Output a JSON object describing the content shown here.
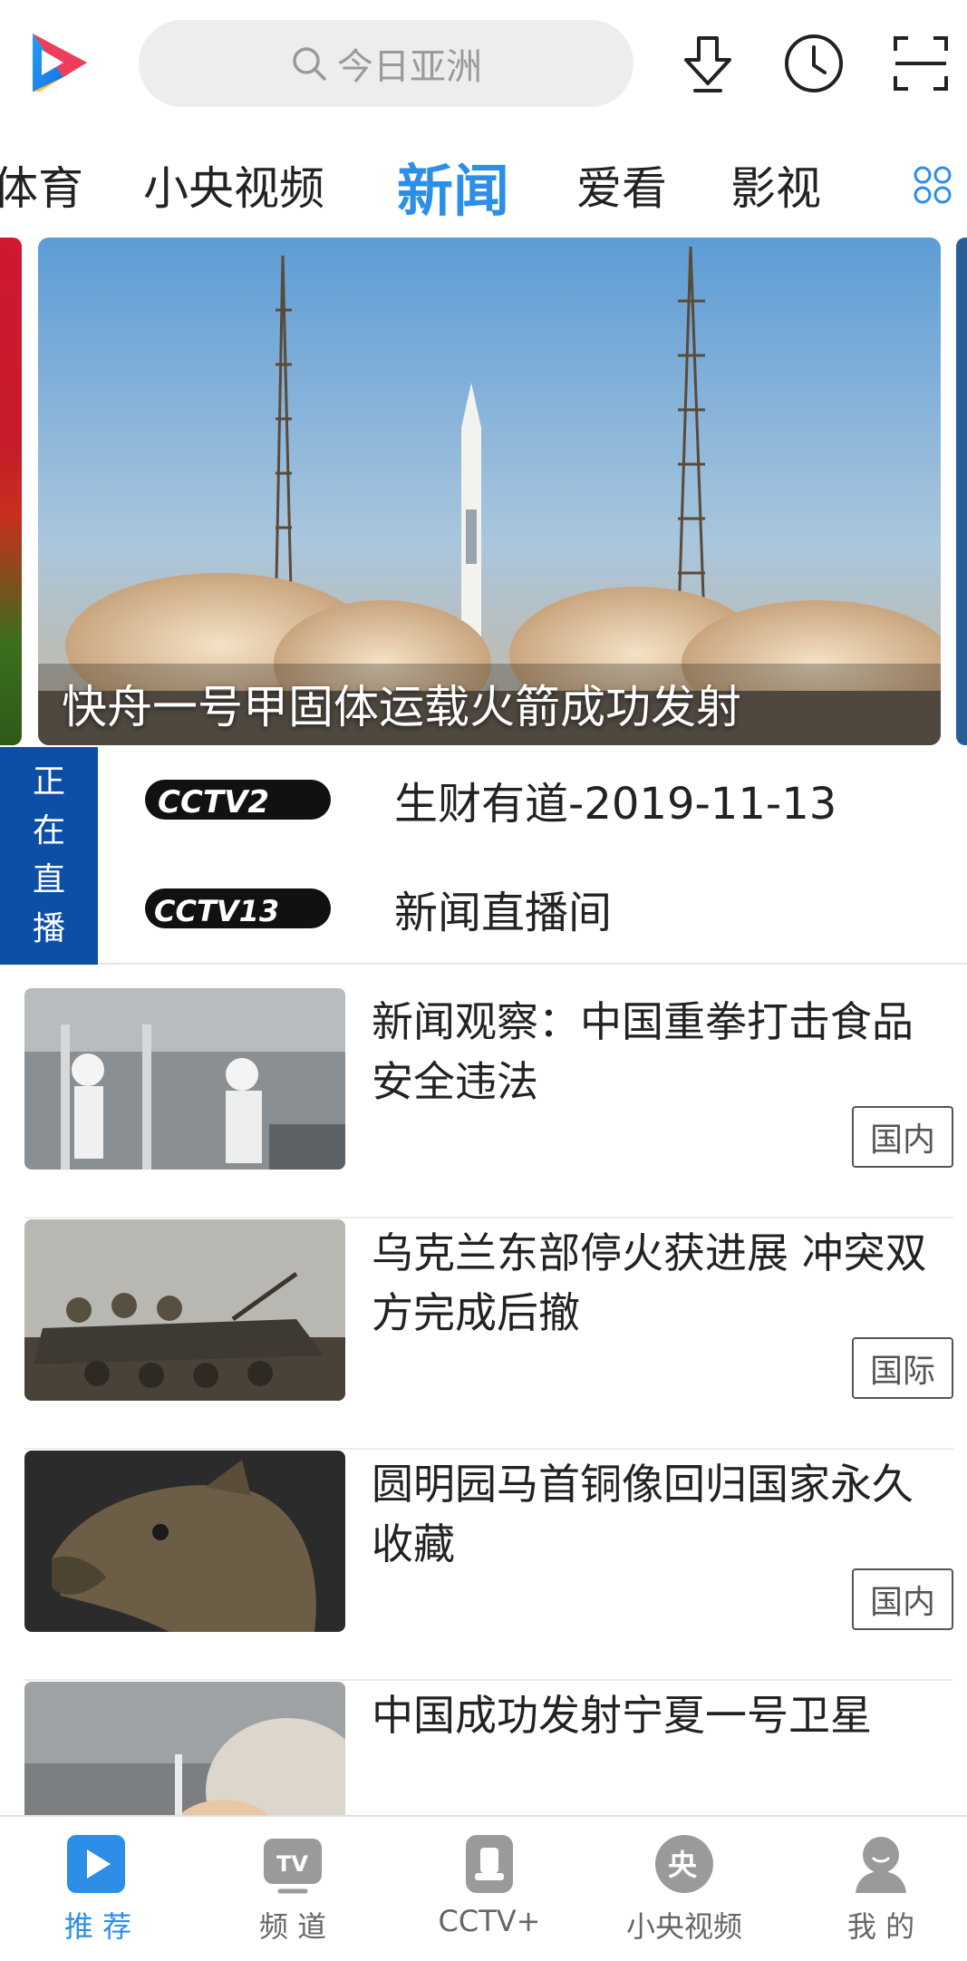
{
  "header": {
    "search_placeholder": "今日亚洲",
    "icons": [
      "app-logo",
      "search-icon",
      "download-icon",
      "history-clock-icon",
      "scan-icon"
    ]
  },
  "tabs": {
    "items": [
      "体育",
      "小央视频",
      "新闻",
      "爱看",
      "影视"
    ],
    "active": "新闻",
    "more_icon": "grid-icon"
  },
  "banner": {
    "caption": "快舟一号甲固体运载火箭成功发射"
  },
  "live": {
    "badge": [
      "正",
      "在",
      "直",
      "播"
    ],
    "channels": [
      {
        "logo": "CCTV2",
        "program": "生财有道-2019-11-13"
      },
      {
        "logo": "CCTV13",
        "program": "新闻直播间"
      }
    ]
  },
  "news": [
    {
      "title": "新闻观察：中国重拳打击食品安全违法",
      "tag": "国内"
    },
    {
      "title": "乌克兰东部停火获进展 冲突双方完成后撤",
      "tag": "国际"
    },
    {
      "title": "圆明园马首铜像回归国家永久收藏",
      "tag": "国内"
    },
    {
      "title": "中国成功发射宁夏一号卫星",
      "tag": ""
    }
  ],
  "bottom_nav": {
    "items": [
      {
        "label": "推 荐",
        "icon": "play-icon"
      },
      {
        "label": "频 道",
        "icon": "tv-icon"
      },
      {
        "label": "CCTV+",
        "icon": "cctv-plus-icon"
      },
      {
        "label": "小央视频",
        "icon": "yang-icon"
      },
      {
        "label": "我 的",
        "icon": "user-icon"
      }
    ],
    "active_index": 0
  },
  "colors": {
    "accent": "#2d8ee8",
    "live_badge": "#0b4fa6"
  }
}
